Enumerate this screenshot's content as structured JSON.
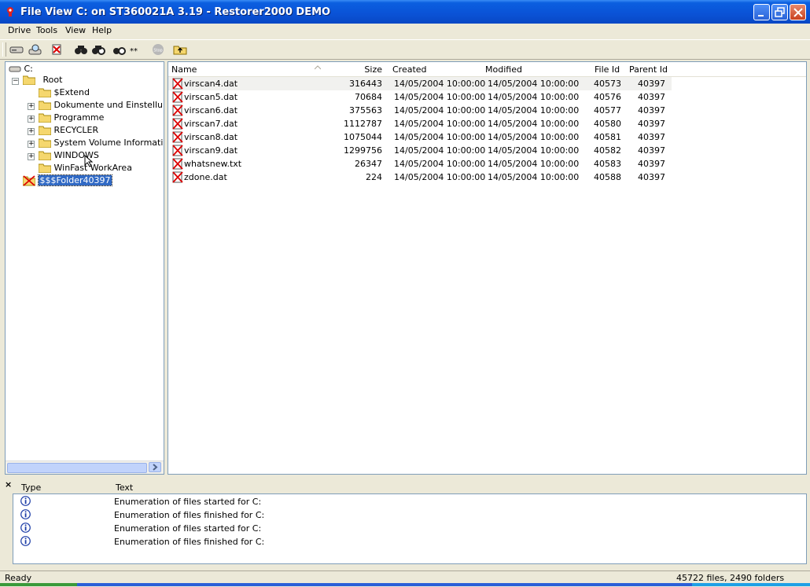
{
  "window": {
    "title": "File View C: on ST360021A 3.19 - Restorer2000 DEMO",
    "icon": "app-icon"
  },
  "menu": [
    "Drive",
    "Tools",
    "View",
    "Help"
  ],
  "toolbar": {
    "stop_label": "Stop",
    "icons": [
      "drive-icon",
      "search-drive-icon",
      "undelete-icon",
      "find-icon",
      "find-next-icon",
      "find-mask-icon",
      "stop-icon",
      "up-folder-icon"
    ]
  },
  "tree": {
    "drive": "C:",
    "root": "Root",
    "items": [
      "$Extend",
      "Dokumente und Einstellungen",
      "Programme",
      "RECYCLER",
      "System Volume Information",
      "WINDOWS",
      "WinFast WorkArea"
    ],
    "selected": "$$$Folder40397"
  },
  "list": {
    "columns": [
      "Name",
      "Size",
      "Created",
      "Modified",
      "File Id",
      "Parent Id"
    ],
    "rows": [
      [
        "virscan4.dat",
        "316443",
        "14/05/2004 10:00:00",
        "14/05/2004 10:00:00",
        "40573",
        "40397"
      ],
      [
        "virscan5.dat",
        "70684",
        "14/05/2004 10:00:00",
        "14/05/2004 10:00:00",
        "40576",
        "40397"
      ],
      [
        "virscan6.dat",
        "375563",
        "14/05/2004 10:00:00",
        "14/05/2004 10:00:00",
        "40577",
        "40397"
      ],
      [
        "virscan7.dat",
        "1112787",
        "14/05/2004 10:00:00",
        "14/05/2004 10:00:00",
        "40580",
        "40397"
      ],
      [
        "virscan8.dat",
        "1075044",
        "14/05/2004 10:00:00",
        "14/05/2004 10:00:00",
        "40581",
        "40397"
      ],
      [
        "virscan9.dat",
        "1299756",
        "14/05/2004 10:00:00",
        "14/05/2004 10:00:00",
        "40582",
        "40397"
      ],
      [
        "whatsnew.txt",
        "26347",
        "14/05/2004 10:00:00",
        "14/05/2004 10:00:00",
        "40583",
        "40397"
      ],
      [
        "zdone.dat",
        "224",
        "14/05/2004 10:00:00",
        "14/05/2004 10:00:00",
        "40588",
        "40397"
      ]
    ]
  },
  "log": {
    "close": "×",
    "columns": [
      "Type",
      "Text"
    ],
    "lines": [
      "Enumeration of files started for C:",
      "Enumeration of files finished for C:",
      "Enumeration of files started for C:",
      "Enumeration of files finished for C:"
    ]
  },
  "status": {
    "left": "Ready",
    "right": "45722 files, 2490 folders"
  },
  "colors": {
    "title_bar": "#0a52d6",
    "selection": "#316ac5",
    "chrome": "#ece9d8"
  }
}
